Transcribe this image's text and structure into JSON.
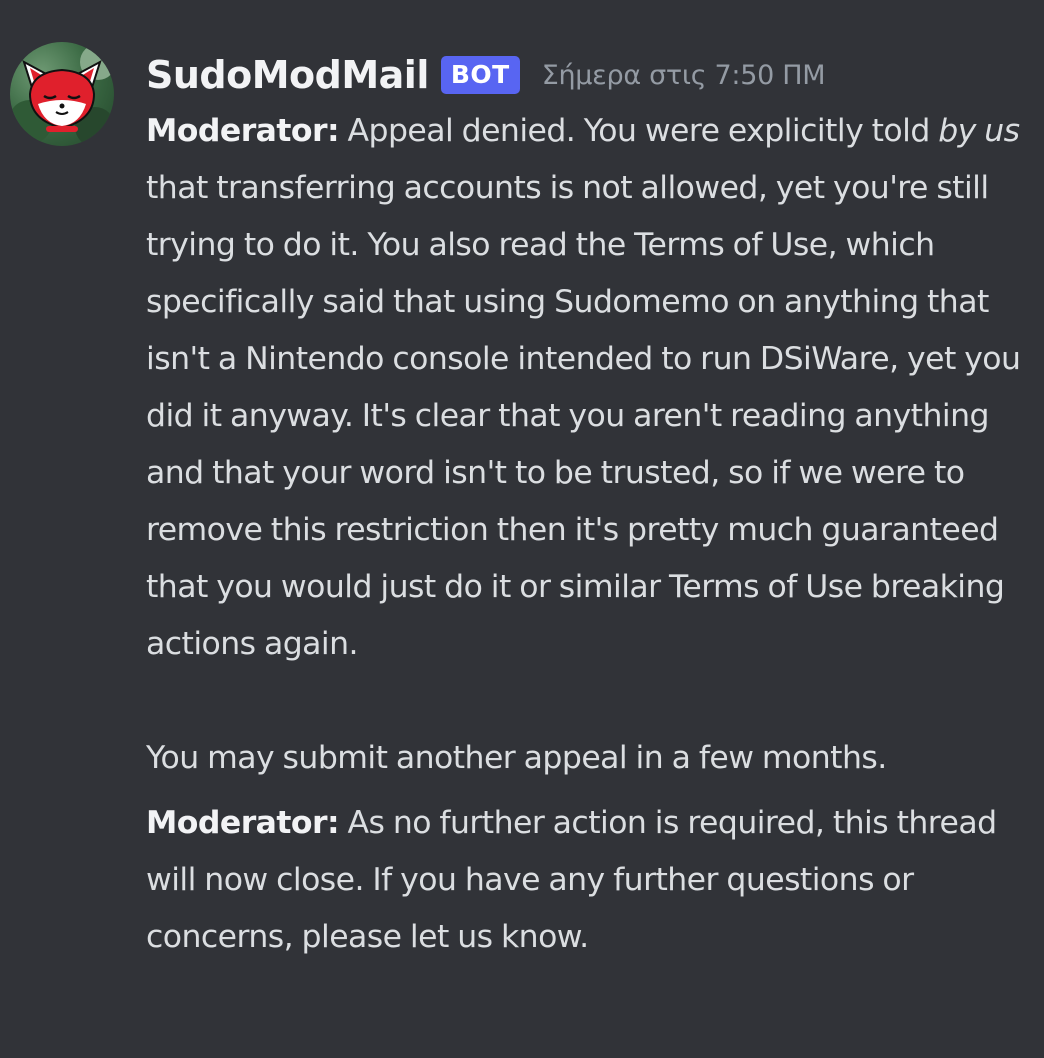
{
  "message": {
    "username": "SudoModMail",
    "bot_tag": "BOT",
    "timestamp": "Σήμερα στις 7:50 ΠΜ",
    "avatar_icon": "fox-avatar-icon",
    "first_block": {
      "speaker": "Moderator:",
      "text_before_emphasis": " Appeal denied. You were explicitly told ",
      "emphasis": "by us",
      "text_after_emphasis": " that transferring accounts is not allowed, yet you're still trying to do it. You also read the Terms of Use, which specifically said that using Sudomemo on anything that isn't a Nintendo console intended to run DSiWare, yet you did it anyway. It's clear that you aren't reading anything and that your word isn't to be trusted, so if we were to remove this restriction then it's pretty much guaranteed that you would just do it or similar Terms of Use breaking actions again.",
      "follow_up": "You may submit another appeal in a few months."
    },
    "second_block": {
      "speaker": "Moderator:",
      "text": " As no further action is required, this thread will now close. If you have any further questions or concerns, please let us know."
    }
  },
  "colors": {
    "background": "#313338",
    "bot_tag": "#5865f2",
    "username": "#f2f3f5",
    "timestamp": "#949ba4",
    "text": "#dbdee1"
  }
}
